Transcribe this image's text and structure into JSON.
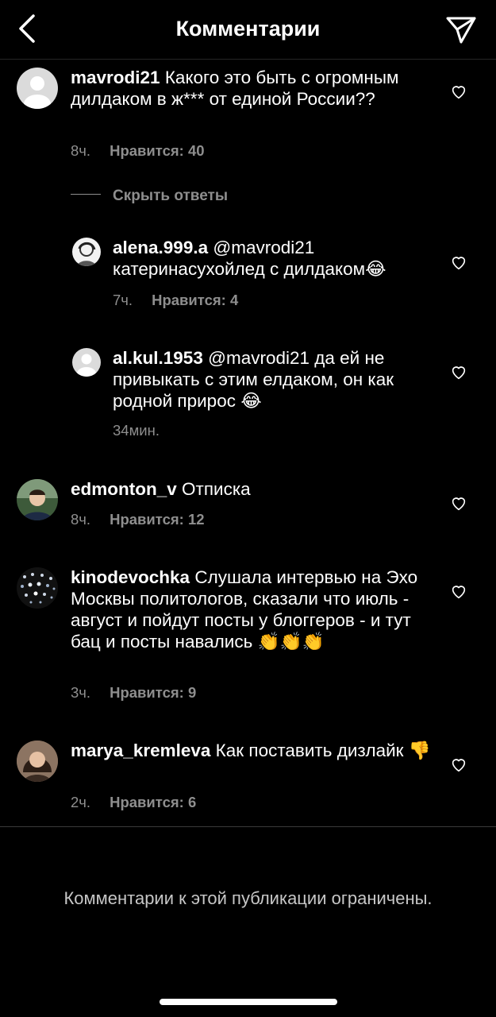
{
  "header": {
    "title": "Комментарии",
    "back_icon": "chevron-left-icon",
    "send_icon": "paper-plane-icon"
  },
  "comments": [
    {
      "user": "mavrodi21",
      "text": "Какого это быть с огромным дилдаком в ж*** от единой России??",
      "time": "8ч.",
      "likes": "Нравится: 40"
    },
    {
      "user": "edmonton_v",
      "text": "Отписка",
      "time": "8ч.",
      "likes": "Нравится: 12"
    },
    {
      "user": "kinodevochka",
      "text": "Слушала интервью на Эхо Москвы политологов, сказали что июль - август и пойдут посты у блоггеров - и тут бац и посты навались",
      "emoji": "👏👏👏",
      "time": "3ч.",
      "likes": "Нравится: 9"
    },
    {
      "user": "marya_kremleva",
      "text": "Как поставить дизлайк",
      "emoji": "👎",
      "time": "2ч.",
      "likes": "Нравится: 6"
    }
  ],
  "hide_replies": "Скрыть ответы",
  "replies": [
    {
      "user": "alena.999.a",
      "text": "@mavrodi21 катеринасухойлед с дилдаком",
      "emoji": "😂",
      "time": "7ч.",
      "likes": "Нравится: 4"
    },
    {
      "user": "al.kul.1953",
      "text": "@mavrodi21 да ей не привыкать с этим елдаком, он как родной прирос",
      "emoji": "😂",
      "time": "34мин."
    }
  ],
  "footer": {
    "closed_message": "Комментарии к этой публикации ограничены."
  }
}
